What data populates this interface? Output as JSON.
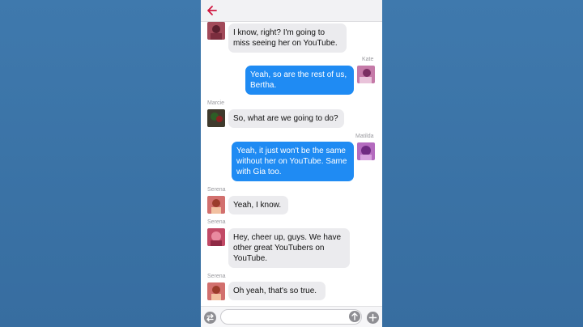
{
  "header": {
    "back_icon": "back-arrow-icon"
  },
  "messages": [
    {
      "sender": "",
      "text": "I know, right? I'm going to miss seeing her on YouTube.",
      "direction": "in"
    },
    {
      "sender": "Kate",
      "text": "Yeah, so are the rest of us, Bertha.",
      "direction": "out"
    },
    {
      "sender": "Marcie",
      "text": "So, what are we going to do?",
      "direction": "in"
    },
    {
      "sender": "Matilda",
      "text": "Yeah, it just won't be the same without her on YouTube. Same with Gia too.",
      "direction": "out"
    },
    {
      "sender": "Serena",
      "text": "Yeah, I know.",
      "direction": "in"
    },
    {
      "sender": "Serena",
      "text": "Hey, cheer up, guys. We have other great YouTubers on YouTube.",
      "direction": "in"
    },
    {
      "sender": "Serena",
      "text": "Oh yeah, that's so true.",
      "direction": "in"
    }
  ],
  "composer": {
    "placeholder": ""
  },
  "colors": {
    "accent": "#d0163f",
    "bubble_out": "#1f8bf3",
    "bubble_in": "#ebebee"
  }
}
